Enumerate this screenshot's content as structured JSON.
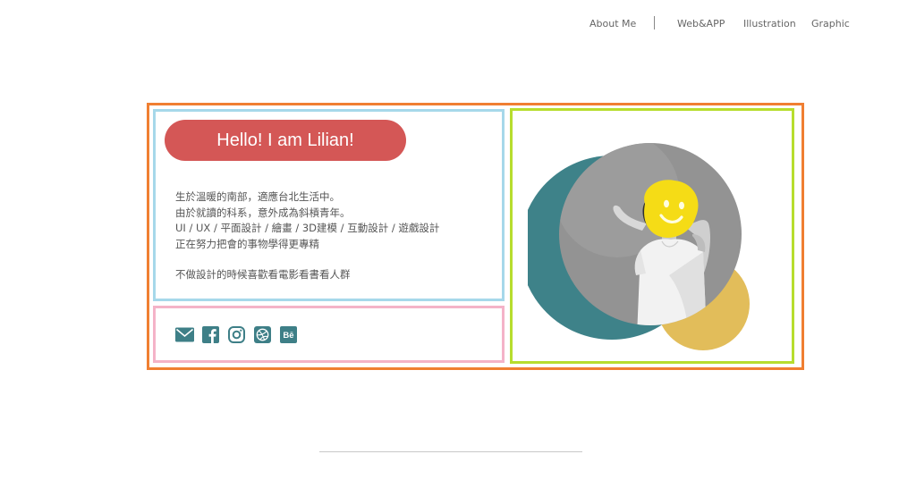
{
  "nav": {
    "items": [
      {
        "label": "About Me"
      },
      {
        "label": "Web&APP"
      },
      {
        "label": "Illustration"
      },
      {
        "label": "Graphic"
      }
    ]
  },
  "intro": {
    "greeting": "Hello! I am Lilian!",
    "bio_lines": [
      "生於溫暖的南部，適應台北生活中。",
      "由於就讀的科系，意外成為斜槓青年。",
      "UI / UX / 平面設計 / 繪畫 / 3D建模 / 互動設計 / 遊戲設計",
      "正在努力把會的事物學得更專精",
      "不做設計的時候喜歡看電影看書看人群"
    ]
  },
  "social": {
    "icons": [
      "mail-icon",
      "facebook-icon",
      "instagram-icon",
      "dribbble-icon",
      "behance-icon"
    ]
  },
  "colors": {
    "frame_outer": "#f07f32",
    "frame_intro": "#a6d8ea",
    "frame_social": "#f4b3c8",
    "frame_photo": "#b7dd2e",
    "greeting_bg": "#d45756",
    "icon_teal": "#3e7f87",
    "circle_teal": "#3e8289",
    "circle_yellow": "#e2bd5a",
    "face_yellow": "#f5dc16"
  }
}
